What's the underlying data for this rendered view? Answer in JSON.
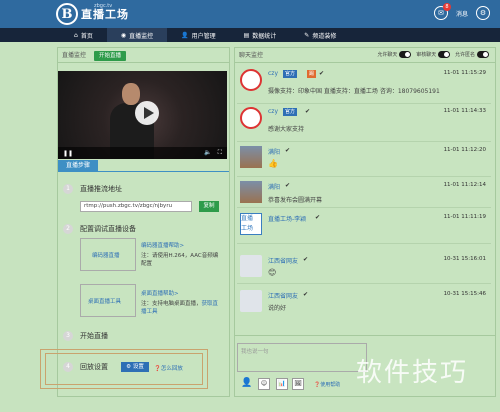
{
  "header": {
    "logo_letter": "B",
    "logo_text": "直播工场",
    "logo_domain": "zbgc.tv",
    "messages_label": "消息",
    "messages_count": "8",
    "settings_icon": "gear-icon"
  },
  "nav": {
    "items": [
      {
        "label": "首页",
        "icon": "home-icon"
      },
      {
        "label": "直播监控",
        "icon": "eye-icon",
        "active": true
      },
      {
        "label": "用户管理",
        "icon": "user-icon"
      },
      {
        "label": "数据统计",
        "icon": "chart-icon"
      },
      {
        "label": "频道装修",
        "icon": "brush-icon"
      }
    ]
  },
  "live_monitor": {
    "title": "直播监控",
    "start_button": "开始直播",
    "video_controls": {
      "pause": "❚❚",
      "volume": "🔈",
      "fullscreen": "⛶"
    }
  },
  "steps": {
    "tab_label": "直播步骤",
    "step1": {
      "num": "1",
      "title": "直播推流地址",
      "url": "rtmp://push.zbgc.tv/zbgc/njbyru",
      "copy_button": "复制"
    },
    "step2": {
      "num": "2",
      "title": "配置调试直播设备",
      "encoder": {
        "link": "编码器直播",
        "help": "编码器直播帮助>",
        "desc": "注：请使用H.264，AAC音频编配置"
      },
      "desktop": {
        "link": "桌面直播工具",
        "help": "桌面直播帮助>",
        "desc": "注：支持电脑桌面直播，",
        "get_link": "获取直播工具"
      }
    },
    "step3": {
      "num": "3",
      "title": "开始直播"
    },
    "step4": {
      "num": "4",
      "title": "回放设置",
      "settings_button": "设置",
      "help_link": "怎么回放"
    }
  },
  "chat_monitor": {
    "title": "聊天监控",
    "toggles": [
      {
        "label": "允许聊天"
      },
      {
        "label": "审核聊天"
      },
      {
        "label": "允许匿名"
      }
    ],
    "messages": [
      {
        "name": "czy",
        "tag1": "官方",
        "tag2": "踢",
        "time": "11-01 11:15:29",
        "text": "摄像支持：印象中国 直播支持：直播工场 咨询：18079605191",
        "avatar": "red"
      },
      {
        "name": "czy",
        "tag1": "官方",
        "time": "11-01 11:14:33",
        "text": "感谢大家支持",
        "avatar": "red"
      },
      {
        "name": "满阳",
        "time": "11-01 11:12:20",
        "text": "👍",
        "avatar": "photo"
      },
      {
        "name": "满阳",
        "time": "11-01 11:12:14",
        "text": "恭喜发布会圆满开幕",
        "avatar": "photo"
      },
      {
        "name": "直播工场-李颖",
        "time": "11-01 11:11:19",
        "text": "",
        "avatar": "logo"
      },
      {
        "name": "江西省网友",
        "time": "10-31 15:16:01",
        "text": "😊",
        "avatar": "gray"
      },
      {
        "name": "江西省网友",
        "time": "10-31 15:15:46",
        "text": "说的好",
        "avatar": "gray"
      }
    ],
    "input_placeholder": "我也说一句",
    "tools": [
      "👤",
      "☺",
      "📊",
      "🖼"
    ],
    "help": "使用帮助"
  },
  "watermark": "软件技巧"
}
